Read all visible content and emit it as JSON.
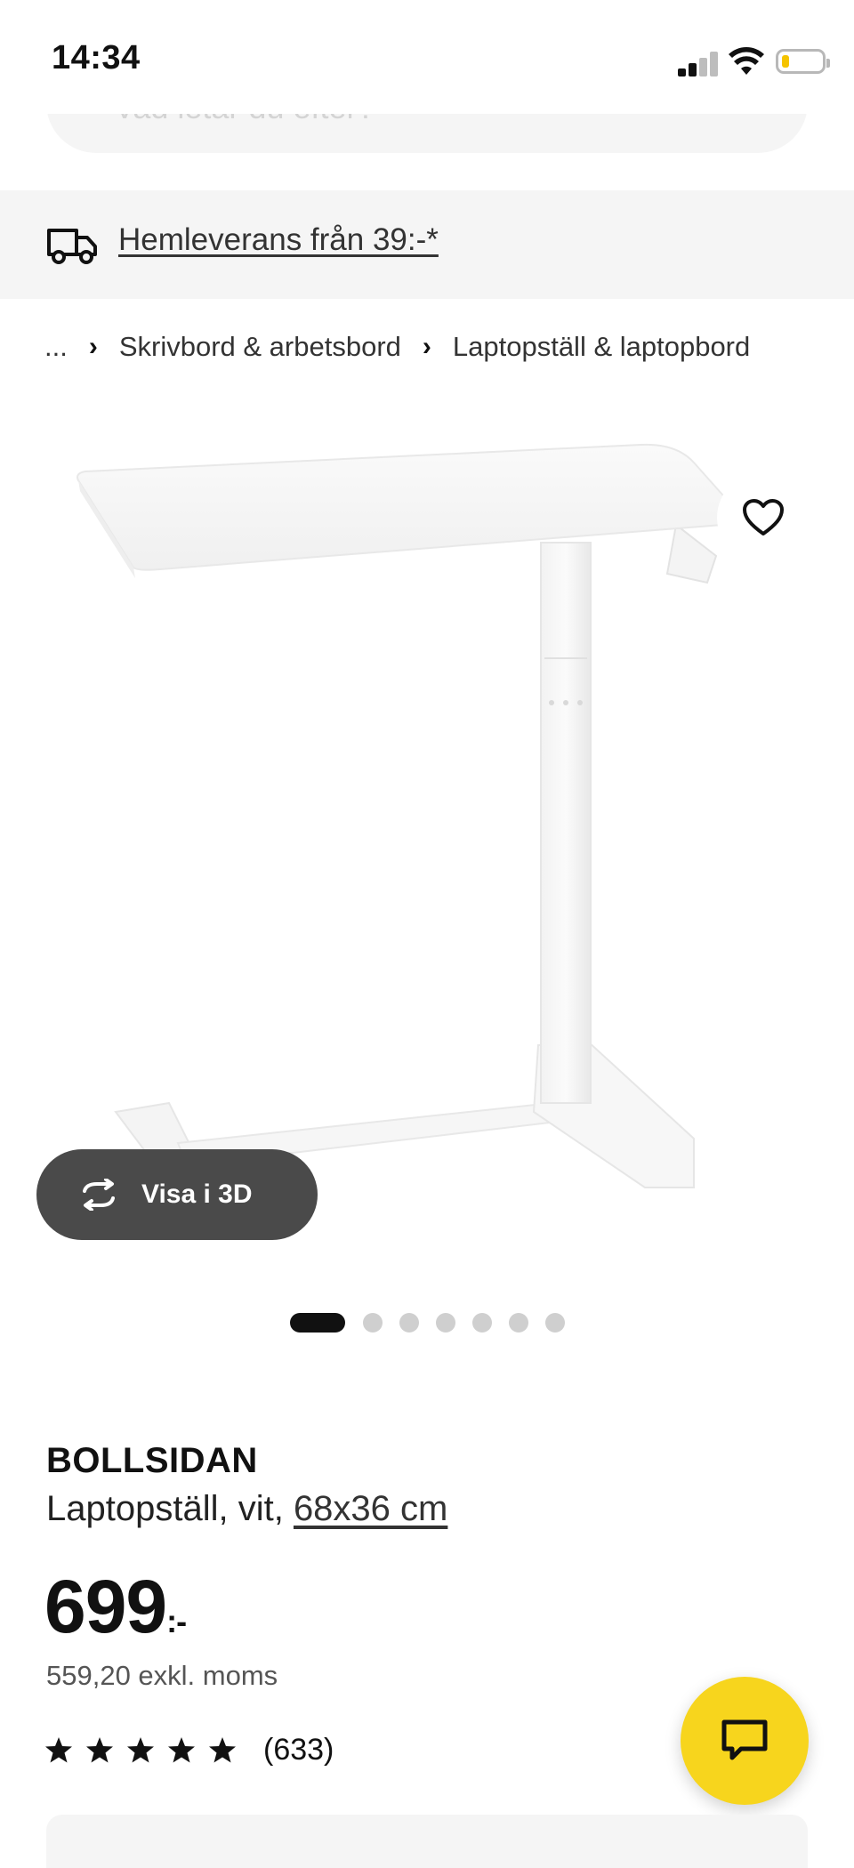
{
  "status_bar": {
    "time": "14:34"
  },
  "search": {
    "placeholder_partial": "Vad letar du efter?"
  },
  "delivery": {
    "text": "Hemleverans från 39:-*",
    "icon": "truck-icon"
  },
  "breadcrumb": {
    "ellipsis": "...",
    "items": [
      "Skrivbord & arbetsbord",
      "Laptopställ & laptopbord"
    ]
  },
  "gallery": {
    "view_3d_label": "Visa i 3D",
    "total_images": 7,
    "active_index": 0
  },
  "product": {
    "name": "BOLLSIDAN",
    "description": "Laptopställ, vit, ",
    "size": "68x36 cm",
    "price": "699",
    "price_suffix": ":-",
    "price_excl_vat": "559,20 exkl. moms",
    "rating_value": 5,
    "rating_count": "(633)"
  },
  "colors": {
    "accent_yellow": "#f7d51d",
    "battery_low": "#f5c400",
    "dark_pill": "#4a4a4a"
  }
}
